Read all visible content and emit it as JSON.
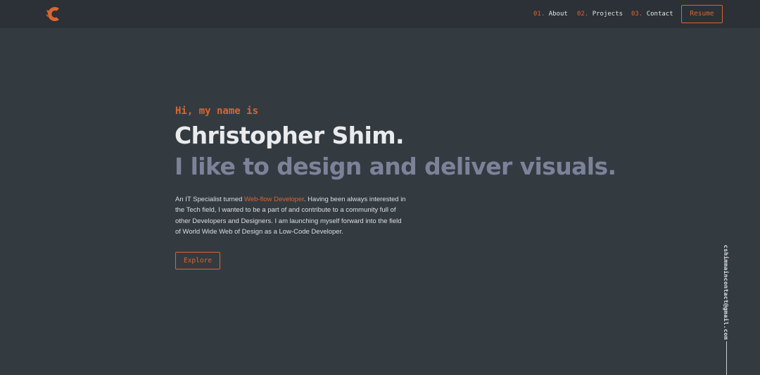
{
  "nav": {
    "items": [
      {
        "num": "01.",
        "label": "About"
      },
      {
        "num": "02.",
        "label": "Projects"
      },
      {
        "num": "03.",
        "label": "Contact"
      }
    ],
    "resume_label": "Resume"
  },
  "logo": {
    "icon": "c-logo-icon",
    "color": "#d9662f"
  },
  "hero": {
    "intro": "Hi, my name is",
    "name": "Christopher Shim.",
    "tagline": "I like to design and deliver visuals.",
    "description": {
      "part1": "An IT Specialist turned ",
      "highlight": "Web-flow Developer",
      "part2": ". Having been always interested in the Tech field, I wanted to be a part of and contribute to a community full of other Developers and Designers. I am launching myself forward into the field of World Wide Web of Design as a Low-Code Developer."
    },
    "explore_label": "Explore"
  },
  "side": {
    "email": "cshimmaincontact@gmail.com"
  },
  "colors": {
    "accent": "#d9662f",
    "background": "#333b41",
    "navbar": "#2b3136",
    "name_text": "#e9ebec",
    "tagline_text": "#7c8399"
  }
}
